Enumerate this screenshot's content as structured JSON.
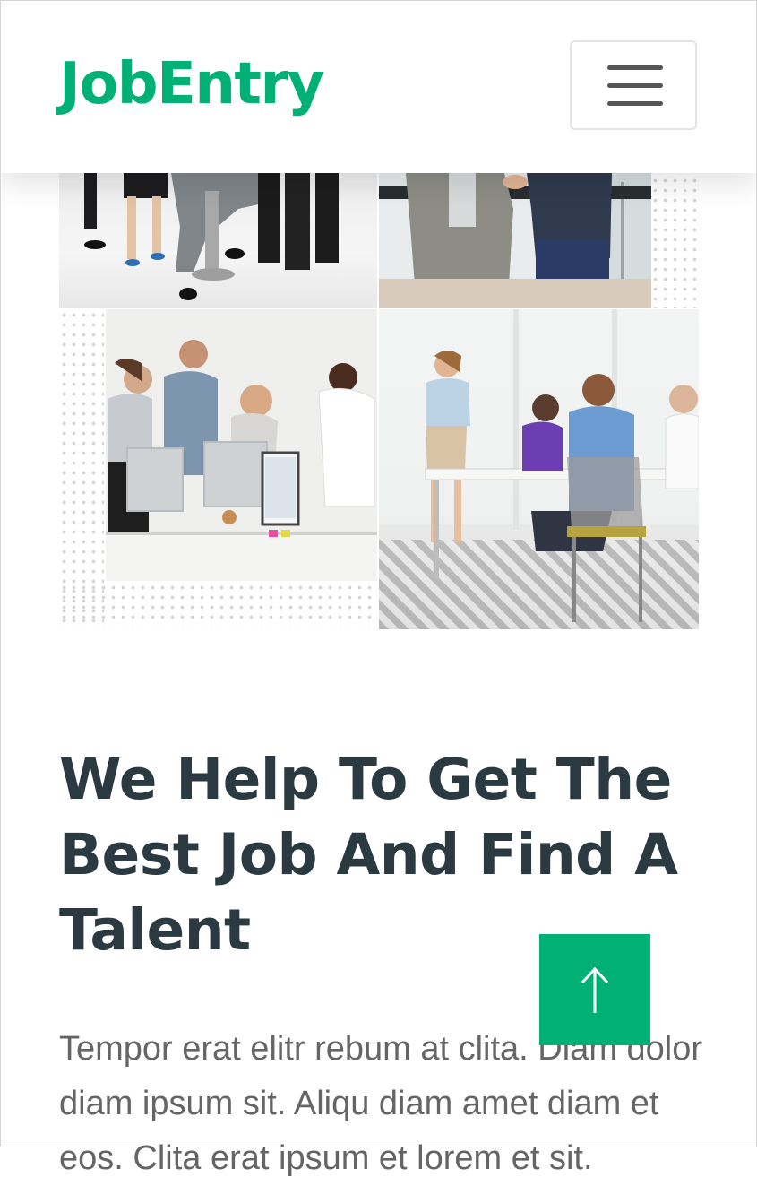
{
  "brand": {
    "name": "JobEntry",
    "color": "#00B074"
  },
  "navbar": {
    "toggler_icon": "hamburger-menu-icon"
  },
  "hero": {
    "heading": "We Help To Get The Best Job And Find A Talent",
    "paragraph": "Tempor erat elitr rebum at clita. Diam dolor diam ipsum sit. Aliqu diam amet diam et eos. Clita erat ipsum et lorem et sit."
  },
  "back_to_top": {
    "icon": "arrow-up-icon",
    "color": "#00B074"
  },
  "colors": {
    "heading": "#2B3940",
    "text": "#666565"
  }
}
